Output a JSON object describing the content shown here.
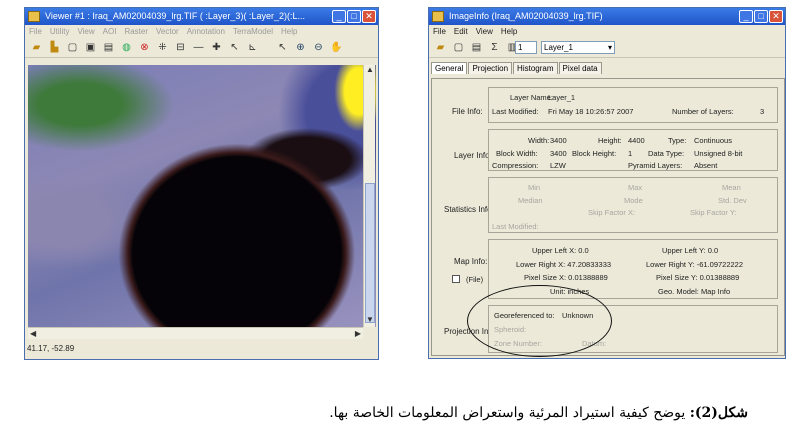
{
  "viewer": {
    "title": "Viewer #1 : Iraq_AM02004039_lrg.TIF ( :Layer_3)( :Layer_2)(:L...",
    "menu": [
      "File",
      "Utility",
      "View",
      "AOI",
      "Raster",
      "Vector",
      "Annotation",
      "TerraModel",
      "Help"
    ],
    "status": "41.17, -52.89"
  },
  "imageinfo": {
    "title": "ImageInfo (Iraq_AM02004039_lrg.TIF)",
    "menu": [
      "File",
      "Edit",
      "View",
      "Help"
    ],
    "layer_spin": "1",
    "layer_select": "Layer_1",
    "tabs": [
      "General",
      "Projection",
      "Histogram",
      "Pixel data"
    ],
    "file_info": {
      "section": "File Info:",
      "layer_name_label": "Layer Name:",
      "layer_name": "Layer_1",
      "last_modified_label": "Last Modified:",
      "last_modified": "Fri May 18 10:26:57 2007",
      "num_layers_label": "Number of Layers:",
      "num_layers": "3"
    },
    "layer_info": {
      "section": "Layer Info:",
      "width_label": "Width:",
      "width": "3400",
      "height_label": "Height:",
      "height": "4400",
      "type_label": "Type:",
      "type": "Continuous",
      "block_width_label": "Block Width:",
      "block_width": "3400",
      "block_height_label": "Block Height:",
      "block_height": "1",
      "data_type_label": "Data Type:",
      "data_type": "Unsigned 8-bit",
      "compression_label": "Compression:",
      "compression": "LZW",
      "pyramid_label": "Pyramid Layers:",
      "pyramid": "Absent"
    },
    "statistics_info": {
      "section": "Statistics Info:",
      "min": "Min",
      "max": "Max",
      "mean": "Mean",
      "median": "Median",
      "mode": "Mode",
      "std_dev": "Std. Dev",
      "skip_x": "Skip Factor X:",
      "skip_y": "Skip Factor Y:",
      "last_modified": "Last Modified:"
    },
    "map_info": {
      "section": "Map Info:",
      "file_check": "(File)",
      "upper_left_x": "Upper Left X: 0.0",
      "upper_left_y": "Upper Left Y: 0.0",
      "lower_right_x": "Lower Right X: 47.20833333",
      "lower_right_y": "Lower Right Y: -61.09722222",
      "pixel_size_x": "Pixel Size X: 0.01388889",
      "pixel_size_y": "Pixel Size Y: 0.01388889",
      "unit": "Unit: inches",
      "geo_model": "Geo. Model: Map Info"
    },
    "projection_info": {
      "section": "Projection Info:",
      "georef_label": "Georeferenced to:",
      "georef_value": "Unknown",
      "spheroid": "Spheroid:",
      "zone": "Zone Number:",
      "datum": "Datum:"
    }
  },
  "caption": {
    "label": "شكل(2):",
    "text": " يوضح كيفية استيراد المرئية واستعراض المعلومات الخاصة بها."
  }
}
